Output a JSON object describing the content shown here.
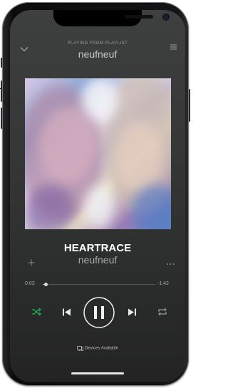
{
  "header": {
    "context_label": "PLAYING FROM PLAYLIST",
    "playlist_name": "neufneuf"
  },
  "track": {
    "title": "HEARTRACE",
    "artist": "neufneuf"
  },
  "playback": {
    "elapsed": "0:03",
    "remaining": "-1:42",
    "progress_fraction": 0.028
  },
  "controls": {
    "shuffle_active": true,
    "accent_color": "#1db954"
  },
  "devices": {
    "label": "Devices Available"
  },
  "icons": [
    "chevron-down-icon",
    "queue-icon",
    "add-icon",
    "more-icon",
    "shuffle-icon",
    "previous-icon",
    "pause-icon",
    "next-icon",
    "repeat-icon",
    "devices-icon"
  ]
}
